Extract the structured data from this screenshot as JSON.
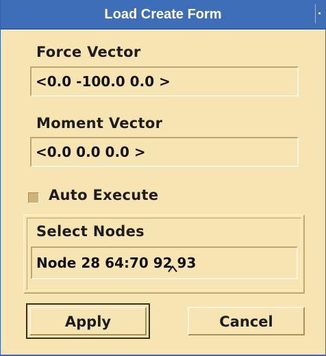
{
  "window": {
    "title": "Load Create Form"
  },
  "form": {
    "force_vector": {
      "label": "Force Vector",
      "value": "<0.0 -100.0 0.0 >"
    },
    "moment_vector": {
      "label": "Moment Vector",
      "value": "<0.0 0.0 0.0 >"
    },
    "auto_execute": {
      "label": "Auto Execute",
      "checked": false
    },
    "select_nodes": {
      "label": "Select Nodes",
      "value": "Node 28 64:70 92 93"
    }
  },
  "buttons": {
    "apply": "Apply",
    "cancel": "Cancel"
  },
  "colors": {
    "background": "#f7e4b3",
    "titlebar": "#3f6eb8",
    "title_text": "#ffffff",
    "text": "#1d1d1d"
  }
}
